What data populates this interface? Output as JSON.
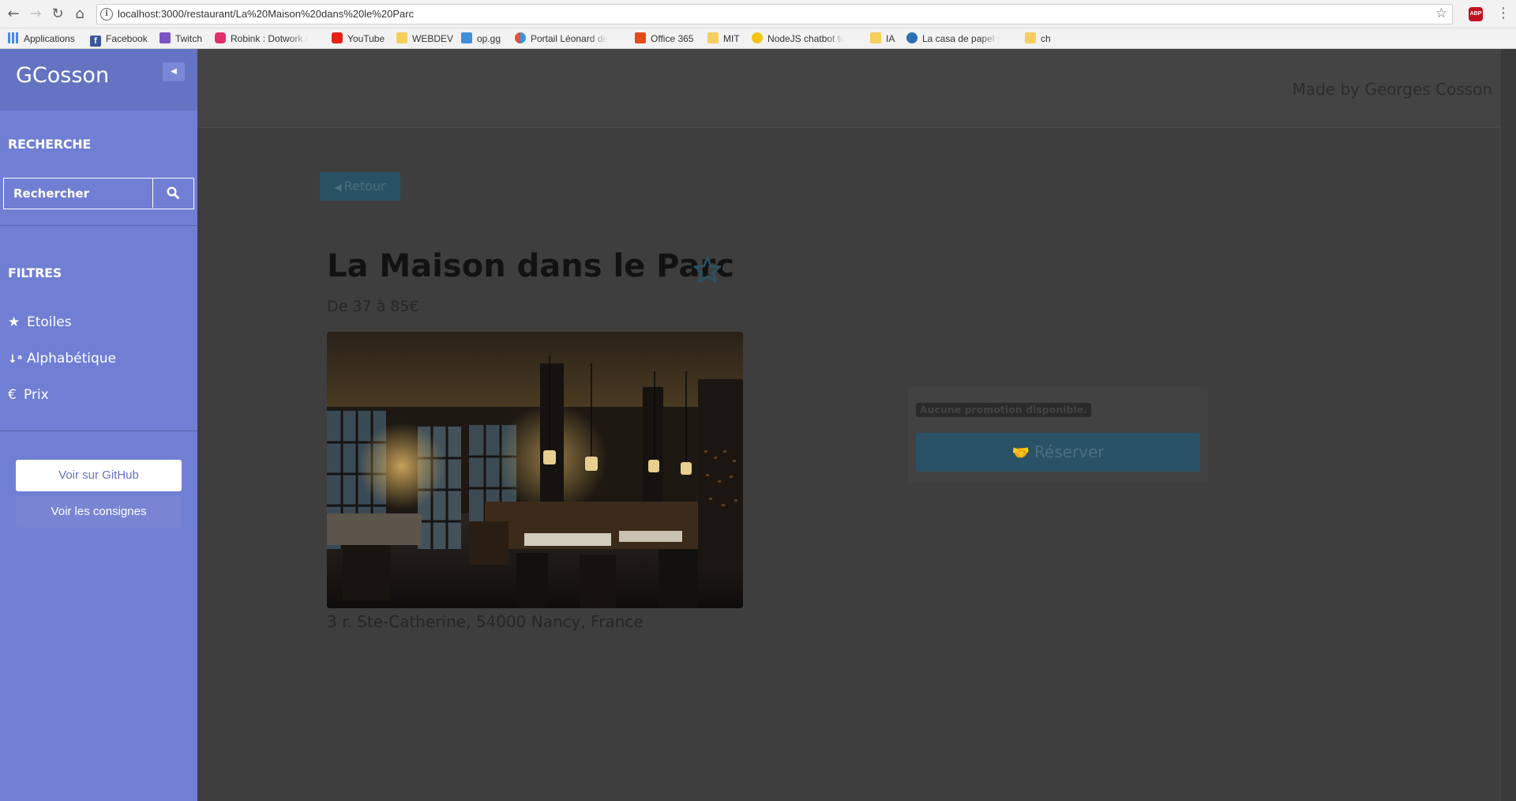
{
  "browser": {
    "url": "localhost:3000/restaurant/La%20Maison%20dans%20le%20Parc",
    "bookmarks": [
      {
        "label": "Applications",
        "icon": "apps-grid-icon"
      },
      {
        "label": "Facebook",
        "icon": "facebook-icon"
      },
      {
        "label": "Twitch",
        "icon": "twitch-icon"
      },
      {
        "label": "Robink : Dotwork Art",
        "icon": "robink-icon"
      },
      {
        "label": "YouTube",
        "icon": "youtube-icon"
      },
      {
        "label": "WEBDEV",
        "icon": "folder-icon"
      },
      {
        "label": "op.gg",
        "icon": "opgg-icon"
      },
      {
        "label": "Portail Léonard de Vi",
        "icon": "portail-icon"
      },
      {
        "label": "Office 365",
        "icon": "office-icon"
      },
      {
        "label": "MIT",
        "icon": "folder-icon"
      },
      {
        "label": "NodeJS chatbot tutor",
        "icon": "chatbot-icon"
      },
      {
        "label": "IA",
        "icon": "folder-icon"
      },
      {
        "label": "La casa de papel sais",
        "icon": "play-icon"
      },
      {
        "label": "ch",
        "icon": "folder-icon"
      }
    ],
    "extension_label": "ABP"
  },
  "sidebar": {
    "brand": "GCosson",
    "search_title": "RECHERCHE",
    "search_placeholder": "Rechercher",
    "filters_title": "FILTRES",
    "filters": [
      {
        "label": "Etoiles",
        "icon": "star-icon"
      },
      {
        "label": "Alphabétique",
        "icon": "sort-alpha-icon"
      },
      {
        "label": "Prix",
        "icon": "euro-icon"
      }
    ],
    "github_button": "Voir sur GitHub",
    "consignes_button": "Voir les consignes"
  },
  "header": {
    "credit": "Made by Georges Cosson"
  },
  "restaurant": {
    "back_label": "Retour",
    "name": "La Maison dans le Parc",
    "price_range": "De 37 à 85€",
    "address": "3 r. Ste-Catherine, 54000 Nancy, France",
    "promotion": "Aucune promotion disponible.",
    "reserve_label": "Réserver"
  },
  "colors": {
    "sidebar": "#707fd3",
    "sidebar_header": "#6473c2",
    "overlay": "#3e3e3e",
    "button": "#2a5266"
  }
}
